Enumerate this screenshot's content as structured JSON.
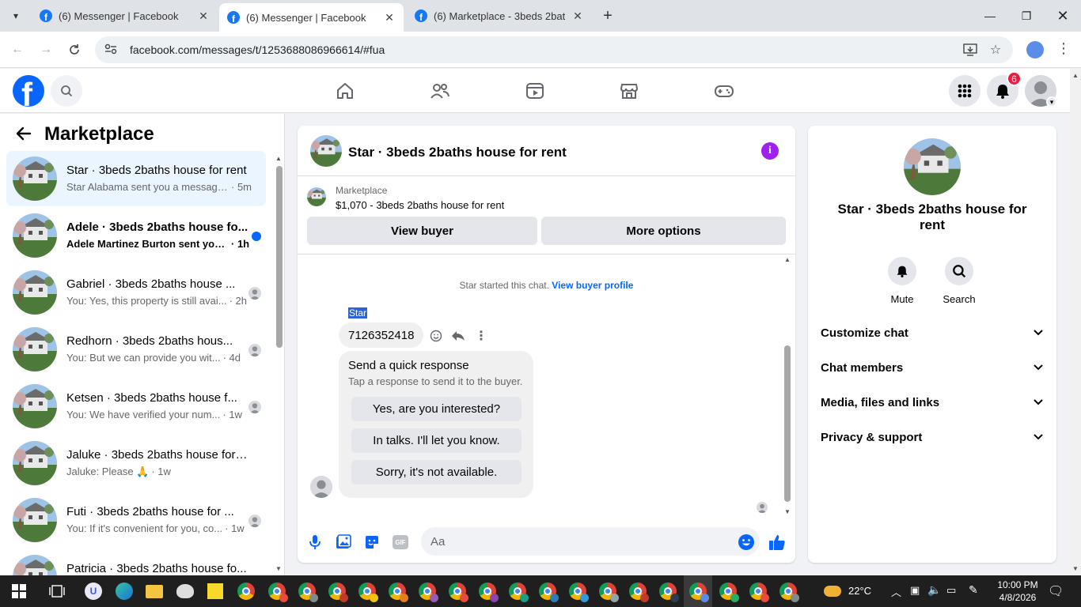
{
  "browser": {
    "tabs": [
      {
        "title": "(6) Messenger | Facebook",
        "active": false
      },
      {
        "title": "(6) Messenger | Facebook",
        "active": true
      },
      {
        "title": "(6) Marketplace - 3beds 2baths",
        "active": false
      }
    ],
    "url": "facebook.com/messages/t/1253688086966614/#fua",
    "new_tab": "+",
    "close_glyph": "✕"
  },
  "facebook": {
    "logo_letter": "f",
    "notification_count": "6"
  },
  "sidebar": {
    "title": "Marketplace",
    "conversations": [
      {
        "name": "Star · 3beds 2baths house for rent",
        "preview": "Star Alabama sent you a message ...",
        "time": "· 5m",
        "active": true,
        "unread": false
      },
      {
        "name": "Adele · 3beds 2baths house fo...",
        "preview": "Adele Martinez Burton sent you...",
        "time": "· 1h",
        "active": false,
        "unread": true
      },
      {
        "name": "Gabriel · 3beds 2baths house ...",
        "preview": "You: Yes, this property is still avai...",
        "time": "· 2h",
        "active": false,
        "unread": false
      },
      {
        "name": "Redhorn · 3beds 2baths hous...",
        "preview": "You: But we can provide you wit...",
        "time": "· 4d",
        "active": false,
        "unread": false
      },
      {
        "name": "Ketsen · 3beds 2baths house f...",
        "preview": "You: We have verified your num...",
        "time": "· 1w",
        "active": false,
        "unread": false
      },
      {
        "name": "Jaluke · 3beds 2baths house for ...",
        "preview": "Jaluke: Please 🙏",
        "time": "· 1w",
        "active": false,
        "unread": false
      },
      {
        "name": "Futi · 3beds 2baths house for ...",
        "preview": "You: If it's convenient for you, co...",
        "time": "· 1w",
        "active": false,
        "unread": false
      },
      {
        "name": "Patricia · 3beds 2baths house fo...",
        "preview": "",
        "time": "",
        "active": false,
        "unread": false
      }
    ]
  },
  "chat": {
    "title": "Star · 3beds 2baths house for rent",
    "listing_label": "Marketplace",
    "listing_title": "$1,070 - 3beds 2baths house for rent",
    "view_buyer": "View buyer",
    "more_options": "More options",
    "started_text": "Star started this chat.",
    "view_profile": "View buyer profile",
    "sender_name": "Star",
    "message": "7126352418",
    "quick_response_title": "Send a quick response",
    "quick_response_subtitle": "Tap a response to send it to the buyer.",
    "quick_responses": [
      "Yes, are you interested?",
      "In talks. I'll let you know.",
      "Sorry, it's not available."
    ],
    "composer_placeholder": "Aa",
    "gif_label": "GIF"
  },
  "info_panel": {
    "name": "Star · 3beds 2baths house for rent",
    "mute_label": "Mute",
    "search_label": "Search",
    "sections": [
      "Customize chat",
      "Chat members",
      "Media, files and links",
      "Privacy & support"
    ]
  },
  "taskbar": {
    "temperature": "22°C",
    "time": "10:00 PM",
    "date": "4/8/2026"
  },
  "colors": {
    "fb_blue": "#0866ff",
    "active_conv": "#ebf5ff",
    "info_purple": "#a020f0",
    "badge_red": "#e41e3f"
  }
}
